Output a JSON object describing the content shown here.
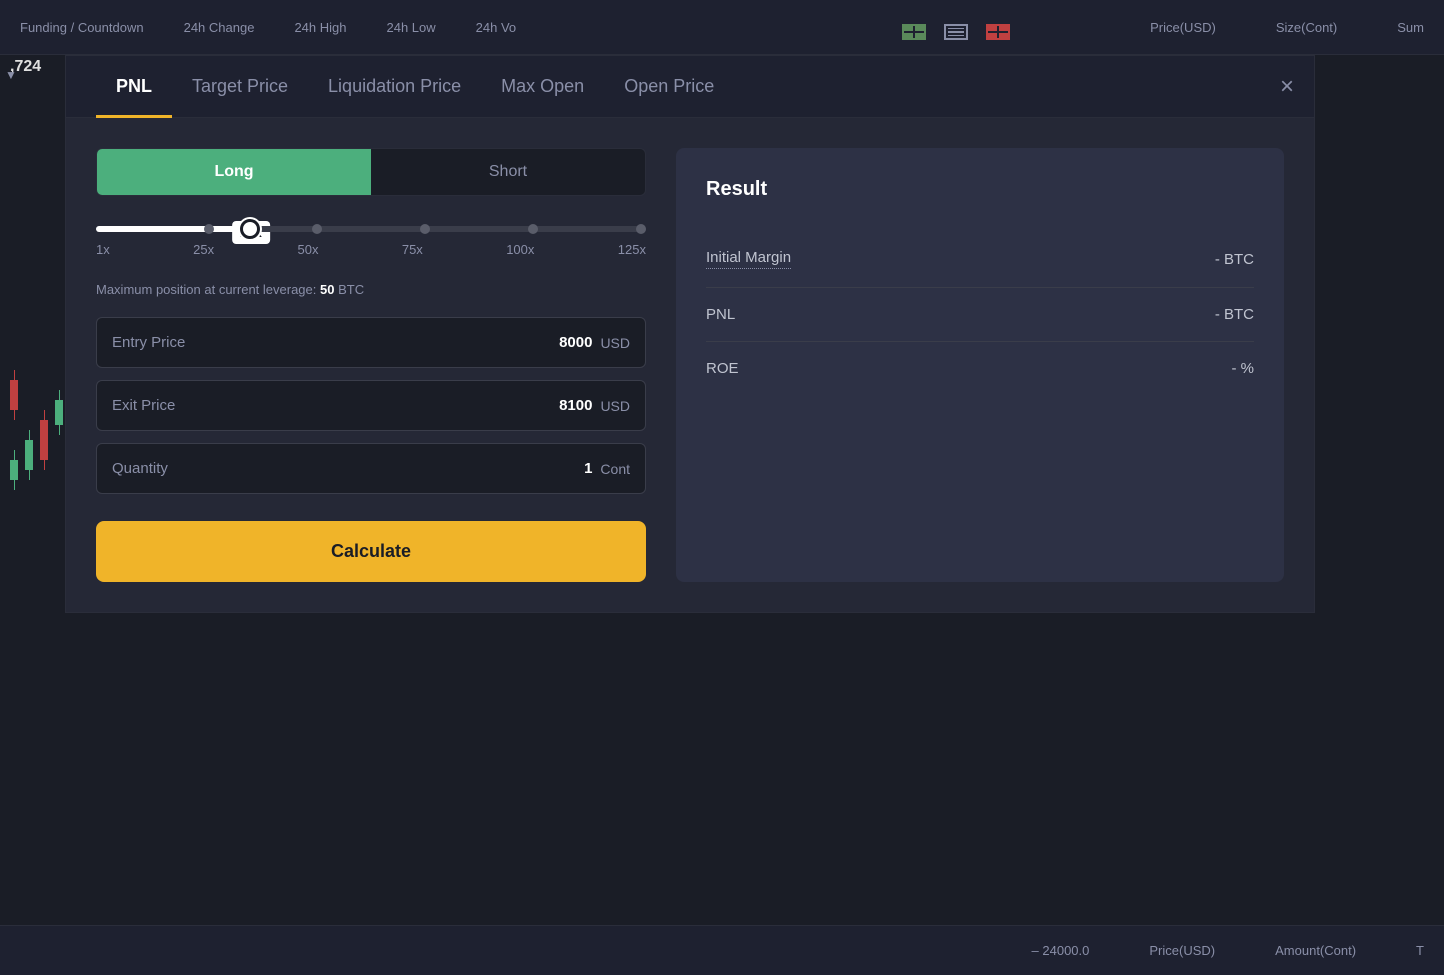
{
  "background": {
    "header_items": [
      "Funding / Countdown",
      "24h Change",
      "24h High",
      "24h Low",
      "24h Vo"
    ],
    "price": ",724",
    "price_arrow": "▼",
    "bottom_items": [
      "– 24000.0",
      "Price(USD)",
      "Amount(Cont)",
      "T"
    ],
    "columns": [
      "Price(USD)",
      "Size(Cont)",
      "Sum"
    ]
  },
  "tabs": [
    {
      "id": "pnl",
      "label": "PNL",
      "active": true
    },
    {
      "id": "target-price",
      "label": "Target Price",
      "active": false
    },
    {
      "id": "liquidation-price",
      "label": "Liquidation Price",
      "active": false
    },
    {
      "id": "max-open",
      "label": "Max Open",
      "active": false
    },
    {
      "id": "open-price",
      "label": "Open Price",
      "active": false
    }
  ],
  "close_label": "×",
  "toggle": {
    "long_label": "Long",
    "short_label": "Short",
    "active": "long"
  },
  "leverage": {
    "current_label": "20x",
    "marks": [
      "1x",
      "25x",
      "50x",
      "75x",
      "100x",
      "125x"
    ],
    "fill_percent": 28,
    "thumb_percent": 28,
    "max_position_text": "Maximum position at current leverage:",
    "max_position_value": "50",
    "max_position_unit": "BTC"
  },
  "inputs": [
    {
      "id": "entry-price",
      "label": "Entry Price",
      "value": "8000",
      "unit": "USD"
    },
    {
      "id": "exit-price",
      "label": "Exit Price",
      "value": "8100",
      "unit": "USD"
    },
    {
      "id": "quantity",
      "label": "Quantity",
      "value": "1",
      "unit": "Cont"
    }
  ],
  "calculate_label": "Calculate",
  "result": {
    "title": "Result",
    "rows": [
      {
        "id": "initial-margin",
        "label": "Initial Margin",
        "underlined": true,
        "value": "- BTC"
      },
      {
        "id": "pnl",
        "label": "PNL",
        "underlined": false,
        "value": "- BTC"
      },
      {
        "id": "roe",
        "label": "ROE",
        "underlined": false,
        "value": "- %"
      }
    ]
  }
}
